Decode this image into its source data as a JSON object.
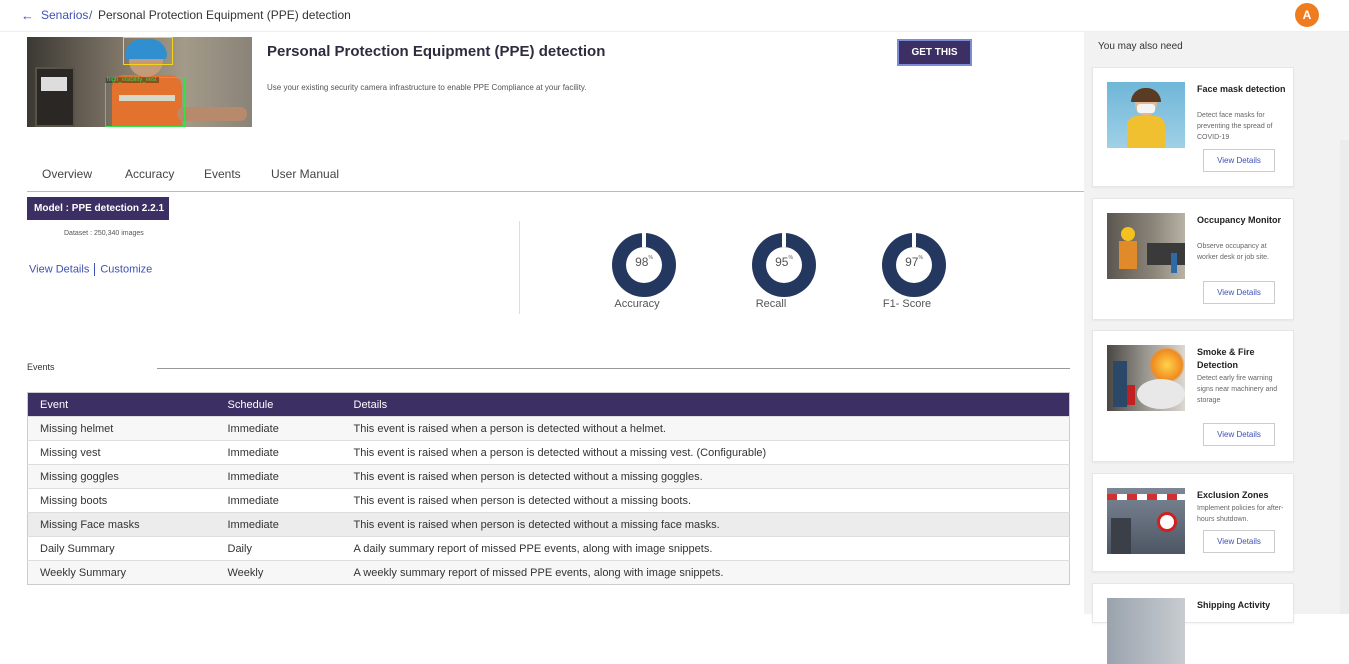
{
  "breadcrumb": {
    "back_icon": "←",
    "link": "Senarios",
    "separator": "/",
    "current": "Personal Protection Equipment (PPE) detection"
  },
  "user": {
    "initial": "A"
  },
  "hero": {
    "tag": "high_visibility_vest"
  },
  "product": {
    "title": "Personal Protection Equipment (PPE) detection",
    "description": "Use your existing security camera infrastructure to enable PPE Compliance at your facility.",
    "cta": "GET THIS"
  },
  "tabs": [
    "Overview",
    "Accuracy",
    "Events",
    "User Manual"
  ],
  "model": {
    "badge": "Model : PPE detection 2.2.1",
    "dataset": "Dataset : 250,340 images",
    "view_details": "View Details",
    "customize": "Customize"
  },
  "metrics": [
    {
      "value": "98",
      "unit": "%",
      "label": "Accuracy",
      "fraction": 0.98
    },
    {
      "value": "95",
      "unit": "%",
      "label": "Recall",
      "fraction": 0.95
    },
    {
      "value": "97",
      "unit": "%",
      "label": "F1- Score",
      "fraction": 0.97
    }
  ],
  "events": {
    "title": "Events",
    "headers": [
      "Event",
      "Schedule",
      "Details"
    ],
    "rows": [
      [
        "Missing helmet",
        "Immediate",
        "This event is raised when a person is detected without a helmet."
      ],
      [
        "Missing vest",
        "Immediate",
        "This event is raised when a person is detected without a missing vest. (Configurable)"
      ],
      [
        "Missing goggles",
        "Immediate",
        "This event is raised when person is detected without a missing goggles."
      ],
      [
        "Missing boots",
        "Immediate",
        "This event is raised when person is detected without a missing boots."
      ],
      [
        "Missing Face masks",
        "Immediate",
        "This event is raised when person is detected without a missing face masks."
      ],
      [
        "Daily Summary",
        "Daily",
        "A daily summary report of missed PPE events, along with image snippets."
      ],
      [
        "Weekly Summary",
        "Weekly",
        "A weekly summary report of missed PPE events, along with image snippets."
      ]
    ]
  },
  "sidebar": {
    "title": "You may also need",
    "cards": [
      {
        "name": "Face mask detection",
        "desc": "Detect face masks for preventing the spread of COVID-19",
        "button": "View Details"
      },
      {
        "name": "Occupancy Monitor",
        "desc": "Observe occupancy at worker desk or job site.",
        "button": "View Details"
      },
      {
        "name": "Smoke & Fire Detection",
        "desc": "Detect early fire warning signs near machinery and storage",
        "button": "View Details"
      },
      {
        "name": "Exclusion Zones",
        "desc": "Implement policies for after-hours shutdown.",
        "button": "View Details"
      },
      {
        "name": "Shipping Activity",
        "desc": "",
        "button": ""
      }
    ]
  },
  "colors": {
    "brand": "#3b2f63",
    "link": "#3f51b5",
    "ring": "#24375f",
    "avatar": "#ef7d1f"
  }
}
